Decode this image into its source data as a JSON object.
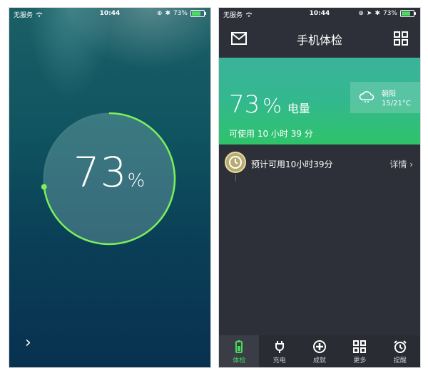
{
  "left_phone": {
    "status": {
      "carrier": "无服务",
      "time": "10:44",
      "battery": "73%"
    },
    "battery_percent": 73,
    "percent_number": "73",
    "percent_unit": "%",
    "next_label": "›"
  },
  "right_phone": {
    "status": {
      "carrier": "无服务",
      "time": "10:44",
      "battery": "73%"
    },
    "header": {
      "title": "手机体检"
    },
    "hero": {
      "percent_number": "73",
      "percent_unit": "%",
      "label": "电量",
      "remaining": "可使用 10 小时 39 分",
      "weather": {
        "city": "朝阳",
        "temp": "15/21°C"
      }
    },
    "estimate": {
      "text": "预计可用10小时39分",
      "detail": "详情 ›"
    },
    "tabs": [
      {
        "label": "体检",
        "icon": "battery-icon",
        "active": true
      },
      {
        "label": "充电",
        "icon": "plug-icon",
        "active": false
      },
      {
        "label": "成就",
        "icon": "plus-circle-icon",
        "active": false
      },
      {
        "label": "更多",
        "icon": "grid-icon",
        "active": false
      },
      {
        "label": "提醒",
        "icon": "alarm-clock-icon",
        "active": false
      }
    ]
  },
  "colors": {
    "accent_green": "#48d85a",
    "ring_green": "#7cf05a",
    "hero_teal": "#33b88e"
  }
}
